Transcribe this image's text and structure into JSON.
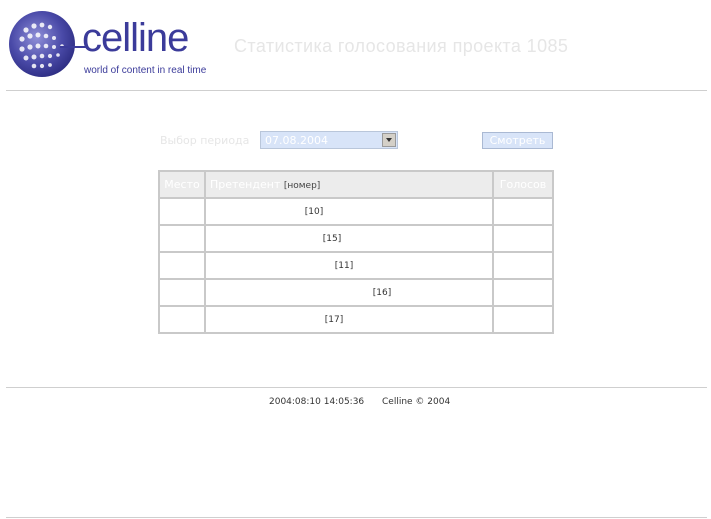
{
  "brand": {
    "name": "celline",
    "tagline": "world of content in real time",
    "color": "#3b3b9a"
  },
  "header": {
    "title": "Статистика голосования проекта 1085"
  },
  "filter": {
    "period_label": "Выбор периода",
    "date_value": "07.08.2004",
    "view_button": "Смотреть"
  },
  "table": {
    "headers": {
      "place": "Место",
      "candidate": "Претендент",
      "candidate_hint": "[номер]",
      "votes": "Голосов"
    },
    "rows": [
      {
        "place": "",
        "candidate": "[10]",
        "votes": ""
      },
      {
        "place": "",
        "candidate": "[15]",
        "votes": ""
      },
      {
        "place": "",
        "candidate": "[11]",
        "votes": ""
      },
      {
        "place": "",
        "candidate": "[16]",
        "votes": ""
      },
      {
        "place": "",
        "candidate": "[17]",
        "votes": ""
      }
    ]
  },
  "footer": {
    "timestamp": "2004:08:10 14:05:36",
    "copyright": "Celline © 2004"
  }
}
